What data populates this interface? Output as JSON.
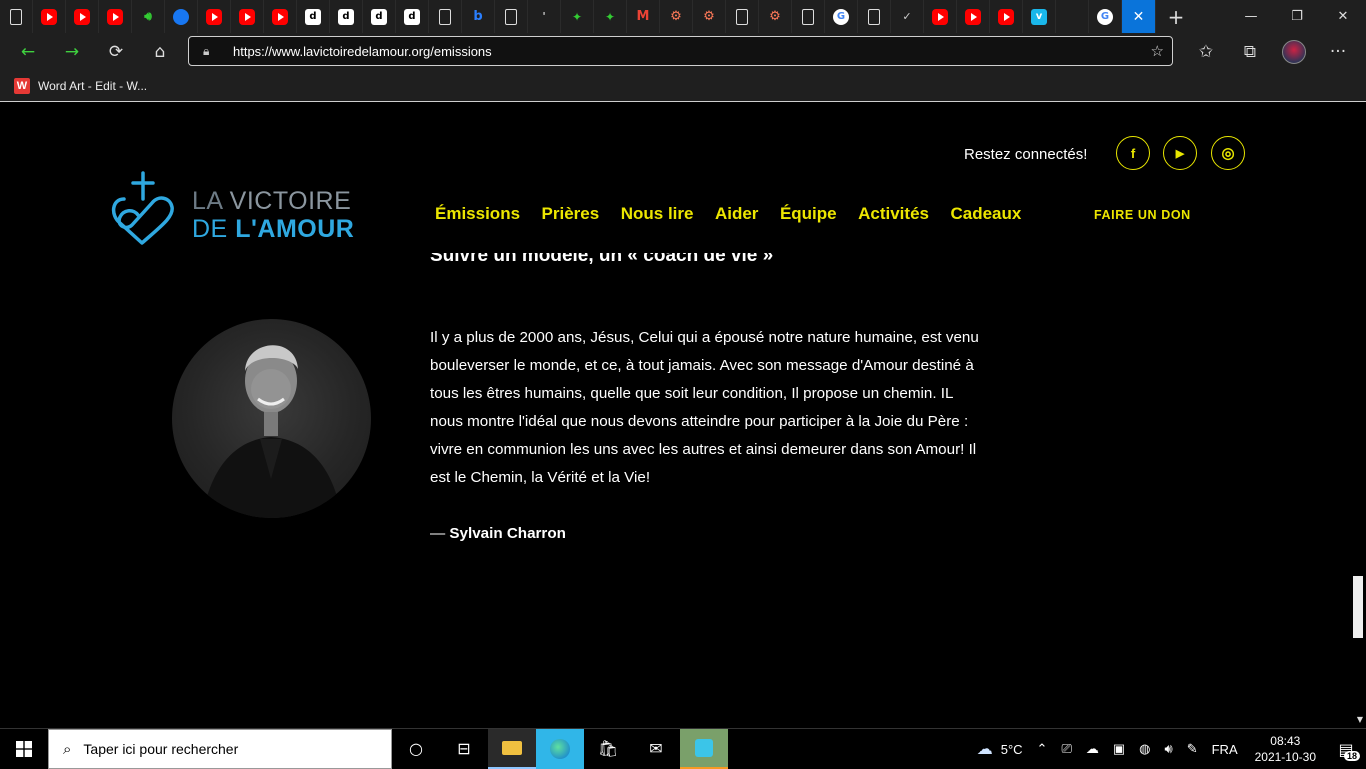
{
  "browser": {
    "tabs": [
      {
        "icon": "tab-actions-icon"
      },
      {
        "icon": "youtube-icon"
      },
      {
        "icon": "youtube-icon"
      },
      {
        "icon": "youtube-icon"
      },
      {
        "icon": "speaker-icon"
      },
      {
        "icon": "facebook-icon"
      },
      {
        "icon": "youtube-icon"
      },
      {
        "icon": "youtube-icon"
      },
      {
        "icon": "youtube-icon"
      },
      {
        "icon": "d-icon",
        "letter": "d"
      },
      {
        "icon": "d-icon",
        "letter": "d"
      },
      {
        "icon": "d-icon",
        "letter": "d"
      },
      {
        "icon": "d-icon",
        "letter": "d"
      },
      {
        "icon": "document-icon"
      },
      {
        "icon": "bing-icon",
        "letter": "b"
      },
      {
        "icon": "document-icon"
      },
      {
        "icon": "generic-icon",
        "letter": "'"
      },
      {
        "icon": "sparkle-icon"
      },
      {
        "icon": "sparkle-icon"
      },
      {
        "icon": "gmail-icon",
        "letter": "M"
      },
      {
        "icon": "hubspot-icon"
      },
      {
        "icon": "hubspot-icon"
      },
      {
        "icon": "document-icon"
      },
      {
        "icon": "hubspot-icon"
      },
      {
        "icon": "document-icon"
      },
      {
        "icon": "google-icon",
        "letter": "G"
      },
      {
        "icon": "document-icon"
      },
      {
        "icon": "generic-icon",
        "letter": "✓"
      },
      {
        "icon": "youtube-icon"
      },
      {
        "icon": "youtube-icon"
      },
      {
        "icon": "youtube-icon"
      },
      {
        "icon": "vimeo-icon",
        "letter": "v"
      },
      {
        "icon": "generic-icon",
        "letter": ""
      },
      {
        "icon": "google-icon",
        "letter": "G"
      }
    ],
    "url": "https://www.lavictoiredelamour.org/emissions",
    "bookmark_label": "Word Art - Edit - W..."
  },
  "site": {
    "connect_label": "Restez connectés!",
    "social": [
      {
        "name": "facebook",
        "glyph": "f"
      },
      {
        "name": "youtube",
        "glyph": "▶"
      },
      {
        "name": "instagram",
        "glyph": "◎"
      }
    ],
    "logo": {
      "line1_a": "LA ",
      "line1_b": "VICTOIRE",
      "line2_a": "DE ",
      "line2_b": "L'AMOUR"
    },
    "nav": [
      "Émissions",
      "Prières",
      "Nous lire",
      "Aider",
      "Équipe",
      "Activités",
      "Cadeaux"
    ],
    "donate_label": "FAIRE UN DON",
    "heading": "Suivre un modèle, un « coach de vie »",
    "quote": "Il y a plus de 2000 ans, Jésus, Celui qui a épousé notre nature humaine, est venu bouleverser le monde, et ce, à tout jamais. Avec son message d'Amour destiné à tous les êtres humains, quelle que soit leur condition, Il propose un chemin. IL nous montre l'idéal que nous devons atteindre pour participer à la Joie du Père : vivre en communion les uns avec les autres et ainsi demeurer dans son Amour! Il est le Chemin, la Vérité et la Vie!",
    "author_dash": "— ",
    "author": "Sylvain Charron"
  },
  "taskbar": {
    "search_placeholder": "Taper ici pour rechercher",
    "weather": "5°C",
    "language": "FRA",
    "time": "08:43",
    "date": "2021-10-30",
    "notifications": "18"
  },
  "colors": {
    "accent_yellow": "#ece600",
    "logo_blue": "#2fa8e0",
    "active_tab": "#0a74da"
  }
}
